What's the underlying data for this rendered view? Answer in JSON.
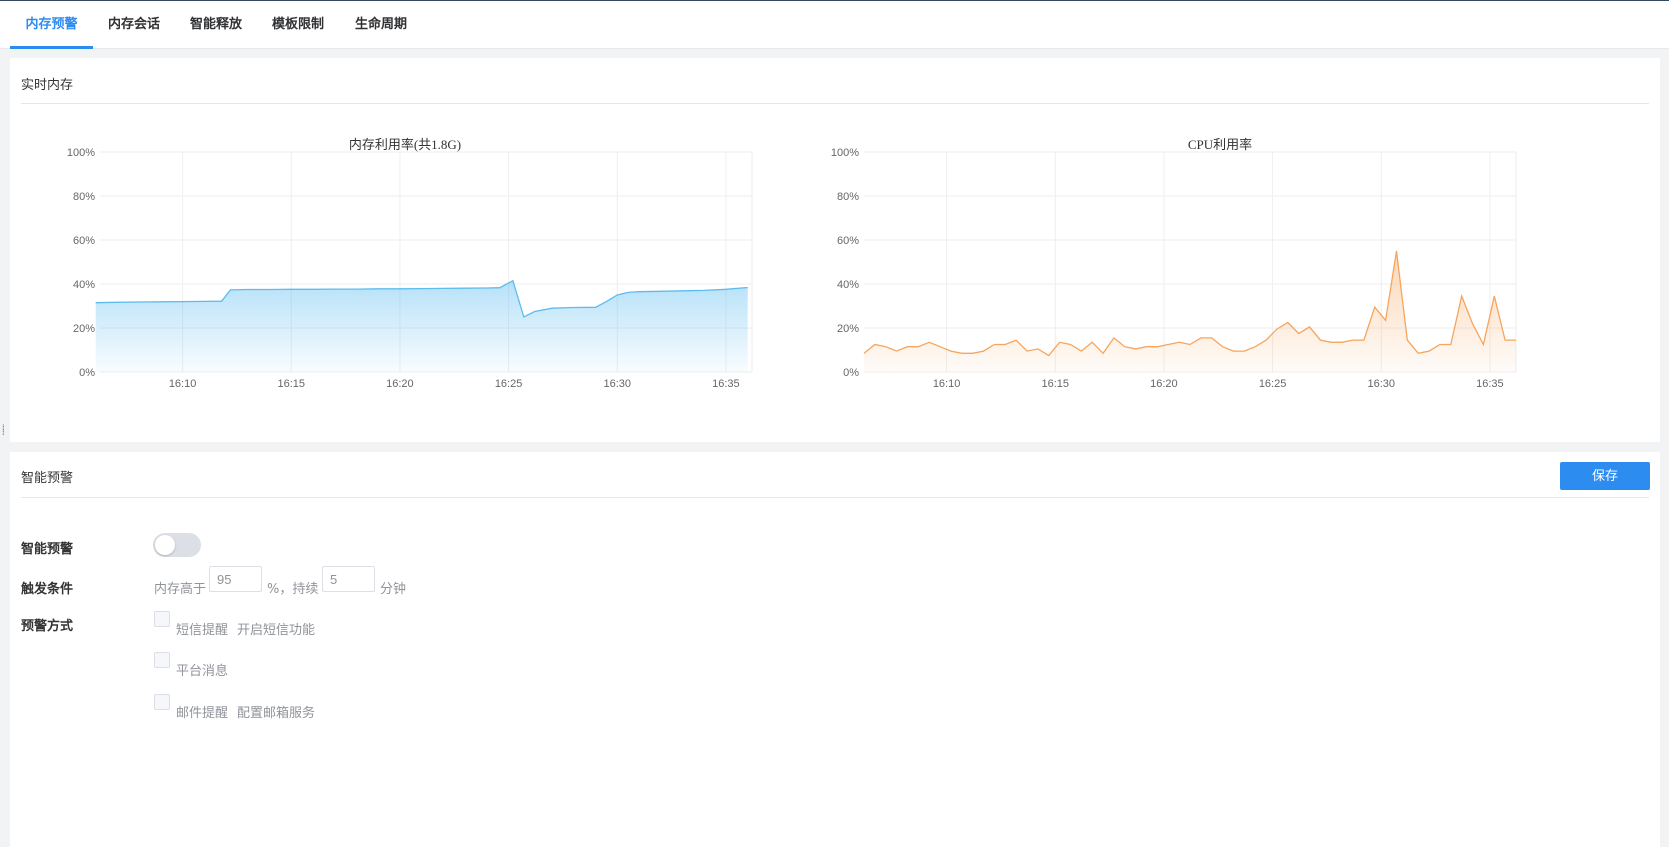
{
  "tabs": [
    {
      "label": "内存预警",
      "active": true
    },
    {
      "label": "内存会话",
      "active": false
    },
    {
      "label": "智能释放",
      "active": false
    },
    {
      "label": "模板限制",
      "active": false
    },
    {
      "label": "生命周期",
      "active": false
    }
  ],
  "realtime": {
    "title": "实时内存"
  },
  "chart_data": [
    {
      "type": "area",
      "title": "内存利用率(共1.8G)",
      "color": "#5cbcf0",
      "x_ticks": [
        "16:10",
        "16:15",
        "16:20",
        "16:25",
        "16:30",
        "16:35"
      ],
      "y_ticks": [
        "0%",
        "20%",
        "40%",
        "60%",
        "80%",
        "100%"
      ],
      "ylim": [
        0,
        100
      ],
      "xlim_minutes": [
        16.2,
        16.6
      ],
      "grid": true,
      "x": [
        "16:06",
        "16:07",
        "16:08",
        "16:09",
        "16:10",
        "16:11",
        "16:11.8",
        "16:12.2",
        "16:13",
        "16:14",
        "16:15",
        "16:16",
        "16:17",
        "16:18",
        "16:19",
        "16:20",
        "16:21",
        "16:22",
        "16:23",
        "16:24",
        "16:24.6",
        "16:25.2",
        "16:25.7",
        "16:26.2",
        "16:27",
        "16:28",
        "16:29",
        "16:29.5",
        "16:30",
        "16:30.5",
        "16:31",
        "16:32",
        "16:33",
        "16:34",
        "16:35",
        "16:36"
      ],
      "values": [
        31.5,
        31.7,
        31.8,
        31.9,
        32.0,
        32.1,
        32.2,
        37.3,
        37.5,
        37.5,
        37.6,
        37.6,
        37.7,
        37.7,
        37.8,
        37.8,
        37.9,
        38.0,
        38.1,
        38.2,
        38.3,
        41.5,
        25.0,
        27.5,
        29.0,
        29.3,
        29.4,
        32.0,
        35.0,
        36.2,
        36.5,
        36.7,
        36.9,
        37.1,
        37.6,
        38.4
      ]
    },
    {
      "type": "area",
      "title": "CPU利用率",
      "color": "#f7a45c",
      "x_ticks": [
        "16:10",
        "16:15",
        "16:20",
        "16:25",
        "16:30",
        "16:35"
      ],
      "y_ticks": [
        "0%",
        "20%",
        "40%",
        "60%",
        "80%",
        "100%"
      ],
      "ylim": [
        0,
        100
      ],
      "grid": true,
      "x": [
        "16:06.2",
        "16:06.7",
        "16:07.2",
        "16:07.7",
        "16:08.2",
        "16:08.7",
        "16:09.2",
        "16:09.7",
        "16:10.2",
        "16:10.7",
        "16:11.2",
        "16:11.7",
        "16:12.2",
        "16:12.7",
        "16:13.2",
        "16:13.7",
        "16:14.2",
        "16:14.7",
        "16:15.2",
        "16:15.7",
        "16:16.2",
        "16:16.7",
        "16:17.2",
        "16:17.7",
        "16:18.2",
        "16:18.7",
        "16:19.2",
        "16:19.7",
        "16:20.2",
        "16:20.7",
        "16:21.2",
        "16:21.7",
        "16:22.2",
        "16:22.7",
        "16:23.2",
        "16:23.7",
        "16:24.2",
        "16:24.7",
        "16:25.2",
        "16:25.7",
        "16:26.2",
        "16:26.7",
        "16:27.2",
        "16:27.7",
        "16:28.2",
        "16:28.7",
        "16:29.2",
        "16:29.7",
        "16:30.2",
        "16:30.7",
        "16:31.2",
        "16:31.7",
        "16:32.2",
        "16:32.7",
        "16:33.2",
        "16:33.7",
        "16:34.2",
        "16:34.7",
        "16:35.2",
        "16:35.7",
        "16:36.2"
      ],
      "values": [
        8.5,
        12.5,
        11.5,
        9.5,
        11.5,
        11.5,
        13.5,
        11.5,
        9.5,
        8.5,
        8.5,
        9.5,
        12.5,
        12.5,
        14.5,
        9.5,
        10.5,
        7.5,
        13.5,
        12.5,
        9.5,
        13.5,
        8.5,
        15.5,
        11.5,
        10.5,
        11.5,
        11.5,
        12.5,
        13.5,
        12.5,
        15.5,
        15.5,
        11.5,
        9.5,
        9.5,
        11.5,
        14.5,
        19.5,
        22.5,
        17.5,
        20.5,
        14.5,
        13.5,
        13.5,
        14.5,
        14.5,
        29.5,
        23.5,
        55.0,
        14.5,
        8.5,
        9.5,
        12.5,
        12.5,
        34.5,
        22.0,
        12.5,
        34.5,
        14.5,
        14.5
      ]
    }
  ],
  "alert": {
    "title": "智能预警",
    "save_label": "保存",
    "enable_label": "智能预警",
    "enabled": false,
    "trigger_label": "触发条件",
    "trigger_prefix": "内存高于",
    "threshold": "95",
    "trigger_mid": "%，持续",
    "duration": "5",
    "trigger_suffix": "分钟",
    "method_label": "预警方式",
    "methods": [
      {
        "label": "短信提醒",
        "link": "开启短信功能"
      },
      {
        "label": "平台消息",
        "link": ""
      },
      {
        "label": "邮件提醒",
        "link": "配置邮箱服务"
      }
    ]
  }
}
